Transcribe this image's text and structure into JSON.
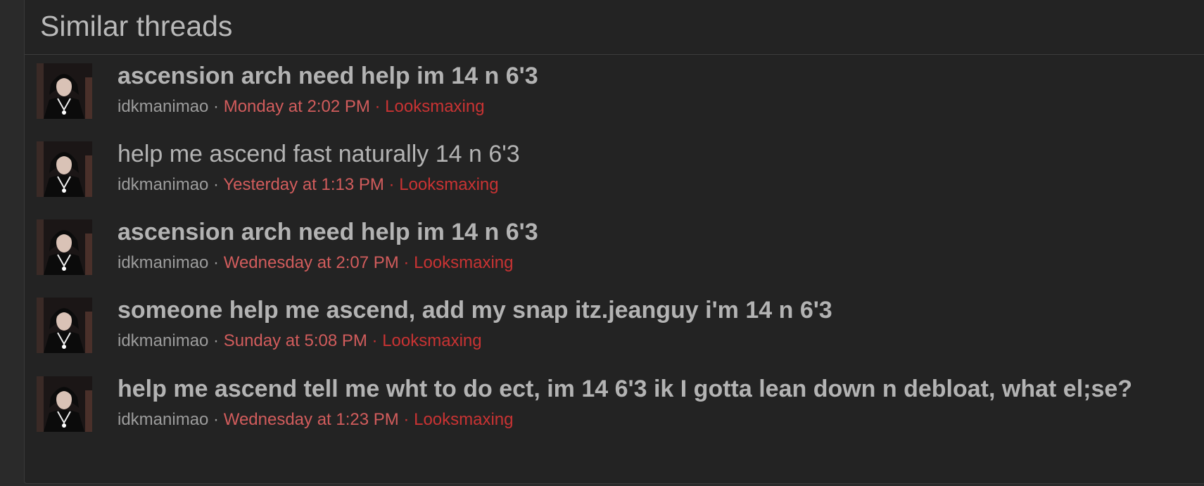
{
  "section": {
    "title": "Similar threads"
  },
  "separator": " · ",
  "threads": [
    {
      "title": "ascension arch need help im 14 n 6'3",
      "author": "idkmanimao",
      "date": "Monday at 2:02 PM",
      "forum": "Looksmaxing",
      "bold": true
    },
    {
      "title": "help me ascend fast naturally 14 n 6'3",
      "author": "idkmanimao",
      "date": "Yesterday at 1:13 PM",
      "forum": "Looksmaxing",
      "bold": false
    },
    {
      "title": "ascension arch need help im 14 n 6'3",
      "author": "idkmanimao",
      "date": "Wednesday at 2:07 PM",
      "forum": "Looksmaxing",
      "bold": true
    },
    {
      "title": "someone help me ascend, add my snap itz.jeanguy i'm 14 n 6'3",
      "author": "idkmanimao",
      "date": "Sunday at 5:08 PM",
      "forum": "Looksmaxing",
      "bold": true
    },
    {
      "title": "help me ascend tell me wht to do ect, im 14 6'3 ik I gotta lean down n debloat, what el;se?",
      "author": "idkmanimao",
      "date": "Wednesday at 1:23 PM",
      "forum": "Looksmaxing",
      "bold": true
    }
  ],
  "colors": {
    "background": "#232323",
    "title_text": "#b3b3b3",
    "author_text": "#9c9c9c",
    "date_text": "#d15c5c",
    "forum_link": "#c93333"
  },
  "icons": {
    "avatar": "user-avatar-icon"
  }
}
